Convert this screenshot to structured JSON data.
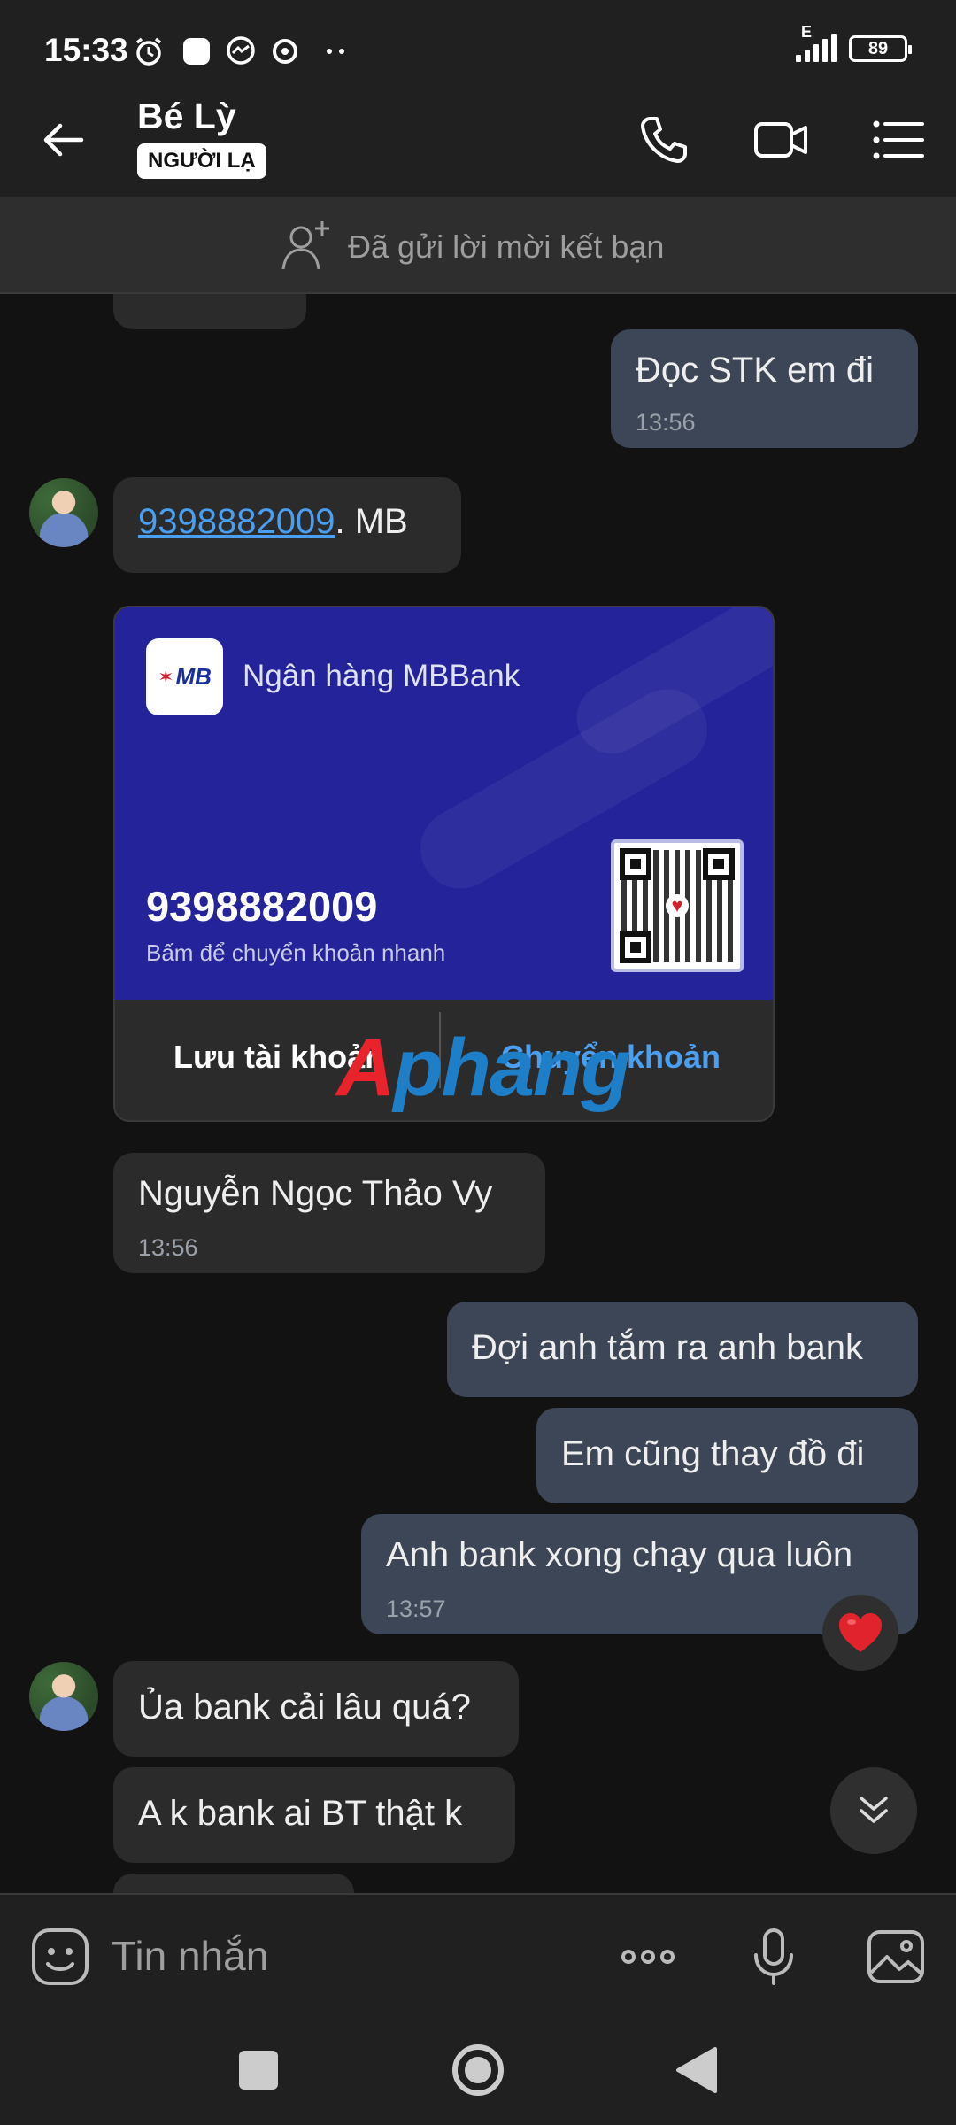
{
  "status_bar": {
    "time": "15:33",
    "network_label": "E",
    "battery_percent": "89"
  },
  "header": {
    "contact_name": "Bé Lỳ",
    "badge": "NGƯỜI LẠ"
  },
  "friend_banner": {
    "text": "Đã gửi lời mời kết bạn"
  },
  "messages": [
    {
      "from": "me",
      "text": "Đọc STK em đi",
      "time": "13:56"
    },
    {
      "from": "them",
      "link_text": "9398882009",
      "text_suffix": ". MB"
    },
    {
      "from": "them",
      "text": "Nguyễn Ngọc Thảo Vy",
      "time": "13:56"
    },
    {
      "from": "me",
      "text": "Đợi anh tắm ra anh bank"
    },
    {
      "from": "me",
      "text": "Em cũng thay đồ đi"
    },
    {
      "from": "me",
      "text": "Anh bank xong chạy qua luôn",
      "time": "13:57"
    },
    {
      "from": "them",
      "text": "Ủa bank cải lâu quá?"
    },
    {
      "from": "them",
      "text": "A k bank ai BT thật k"
    }
  ],
  "bank_card": {
    "logo_text": "MB",
    "bank_name": "Ngân hàng MBBank",
    "account_number": "9398882009",
    "hint": "Bấm để chuyển khoản nhanh",
    "save_label": "Lưu tài khoản",
    "transfer_label": "Chuyển khoản",
    "colors": {
      "card_blue": "#24239a",
      "transfer": "#4a9ff0"
    }
  },
  "watermark": {
    "first": "A",
    "rest": "phang"
  },
  "composer": {
    "placeholder": "Tin nhắn"
  },
  "colors": {
    "accent_link": "#4a9ff0",
    "outgoing_bubble": "#3c4656",
    "incoming_bubble": "#2b2b2b",
    "reaction_heart": "#e0232d"
  },
  "icons": [
    "back-arrow-icon",
    "phone-icon",
    "video-call-icon",
    "menu-list-icon",
    "add-friend-icon",
    "sticker-icon",
    "more-dots-icon",
    "microphone-icon",
    "image-icon",
    "heart-icon",
    "chevron-double-down-icon"
  ]
}
